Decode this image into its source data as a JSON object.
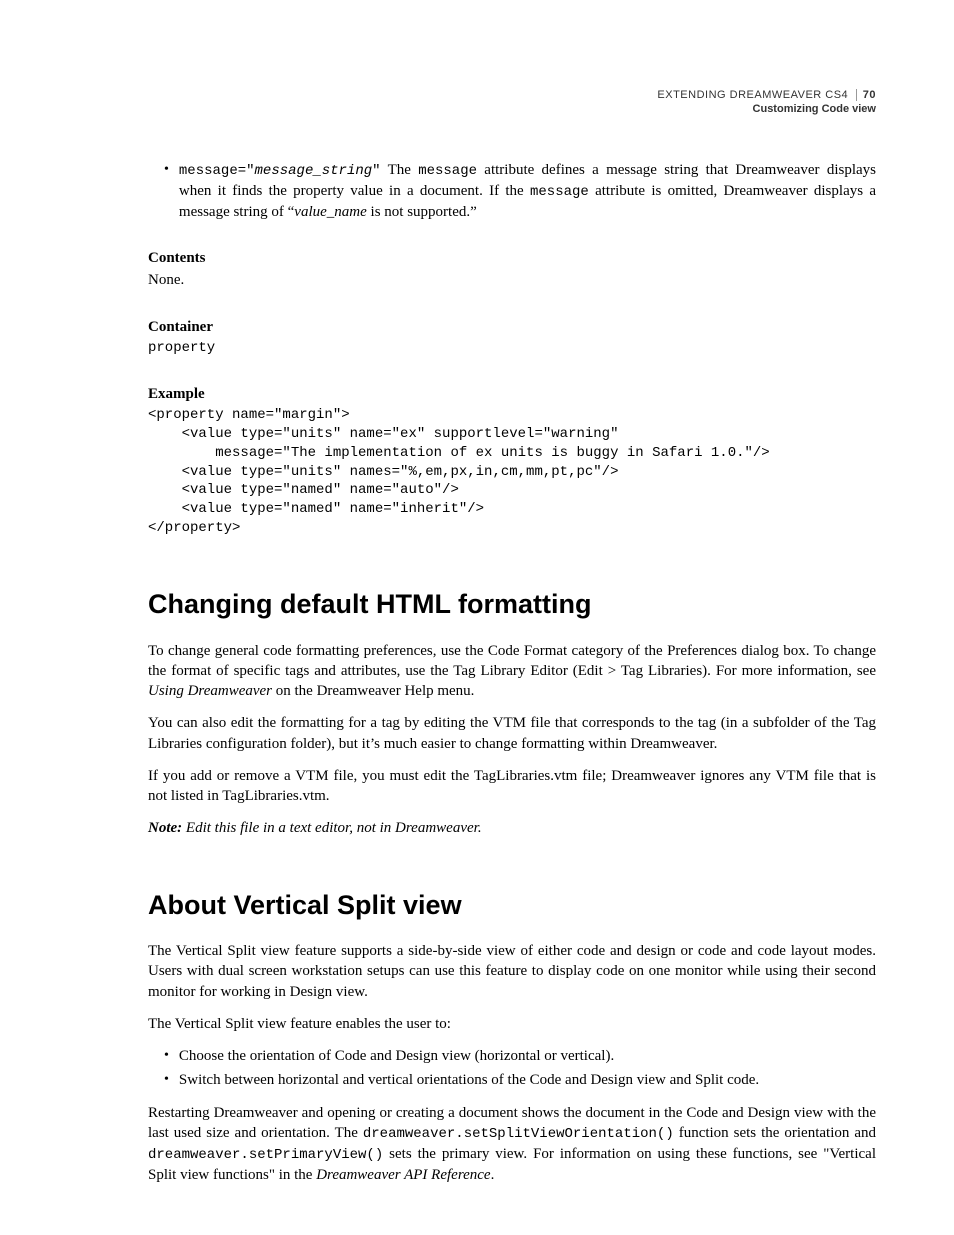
{
  "header": {
    "title": "EXTENDING DREAMWEAVER CS4",
    "page": "70",
    "subtitle": "Customizing Code view"
  },
  "bullet_msg": {
    "code1": "message=\"",
    "ital1": "message_string",
    "code2": "\"",
    "t1": " The ",
    "code3": "message",
    "t2": " attribute defines a message string that Dreamweaver displays when it finds the property value in a document. If the ",
    "code4": "message",
    "t3": " attribute is omitted, Dreamweaver displays a message string of “",
    "ital2": "value_name",
    "t4": " is not supported.”"
  },
  "contents": {
    "label": "Contents",
    "value": "None."
  },
  "container": {
    "label": "Container",
    "value": "property"
  },
  "example": {
    "label": "Example",
    "code": "<property name=\"margin\">\n    <value type=\"units\" name=\"ex\" supportlevel=\"warning\"\n        message=\"The implementation of ex units is buggy in Safari 1.0.\"/>\n    <value type=\"units\" names=\"%,em,px,in,cm,mm,pt,pc\"/>\n    <value type=\"named\" name=\"auto\"/>\n    <value type=\"named\" name=\"inherit\"/>\n</property>"
  },
  "section1": {
    "title": "Changing default HTML formatting",
    "p1a": "To change general code formatting preferences, use the Code Format category of the Preferences dialog box. To change the format of specific tags and attributes, use the Tag Library Editor (Edit > Tag Libraries). For more information, see ",
    "p1i": "Using Dreamweaver",
    "p1b": " on the Dreamweaver Help menu.",
    "p2": "You can also edit the formatting for a tag by editing the VTM file that corresponds to the tag (in a subfolder of the Tag Libraries configuration folder), but it’s much easier to change formatting within Dreamweaver.",
    "p3": "If you add or remove a VTM file, you must edit the TagLibraries.vtm file; Dreamweaver ignores any VTM file that is not listed in TagLibraries.vtm.",
    "note_label": "Note:",
    "note_text": " Edit this file in a text editor, not in Dreamweaver."
  },
  "section2": {
    "title": "About Vertical Split view",
    "p1": "The Vertical Split view feature supports a side-by-side view of either code and design or code and code layout modes. Users with dual screen workstation setups can use this feature to display code on one monitor while using their second monitor for working in Design view.",
    "p2": "The Vertical Split view feature enables the user to:",
    "b1": "Choose the orientation of Code and Design view (horizontal or vertical).",
    "b2": "Switch between horizontal and vertical orientations of the Code and Design view and Split code.",
    "p3a": "Restarting Dreamweaver and opening or creating a document shows the document in the Code and Design view with the last used size and orientation. The ",
    "p3c1": "dreamweaver.setSplitViewOrientation()",
    "p3b": " function sets the orientation and ",
    "p3c2": "dreamweaver.setPrimaryView()",
    "p3c": " sets the primary view. For information on using these functions, see \"Vertical Split view functions\" in the ",
    "p3i": "Dreamweaver API Reference",
    "p3d": "."
  }
}
